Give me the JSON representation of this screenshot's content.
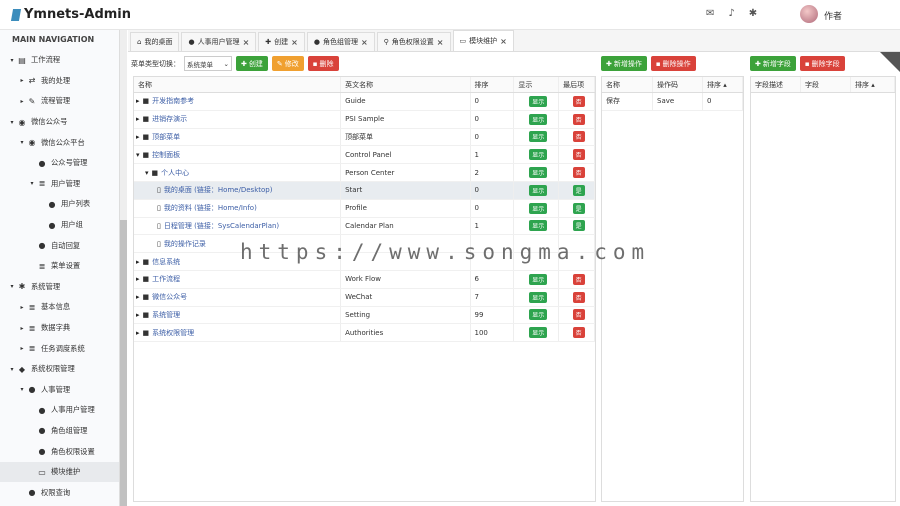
{
  "app": {
    "title": "Ymnets-Admin",
    "user": "作者"
  },
  "sidebar": {
    "header": "MAIN NAVIGATION",
    "items": [
      {
        "label": "工作流程",
        "level": 0,
        "caret": "▾",
        "icon": "▤"
      },
      {
        "label": "我的处理",
        "level": 1,
        "caret": "▸",
        "icon": "⇄"
      },
      {
        "label": "流程管理",
        "level": 1,
        "caret": "▸",
        "icon": "✎"
      },
      {
        "label": "微信公众号",
        "level": 0,
        "caret": "▾",
        "icon": "◉"
      },
      {
        "label": "微信公众平台",
        "level": 1,
        "caret": "▾",
        "icon": "◉"
      },
      {
        "label": "公众号管理",
        "level": 2,
        "caret": "",
        "icon": "●"
      },
      {
        "label": "用户管理",
        "level": 2,
        "caret": "▾",
        "icon": "≣"
      },
      {
        "label": "用户列表",
        "level": 3,
        "caret": "",
        "icon": "●"
      },
      {
        "label": "用户组",
        "level": 3,
        "caret": "",
        "icon": "●"
      },
      {
        "label": "自动回复",
        "level": 2,
        "caret": "",
        "icon": "●"
      },
      {
        "label": "菜单设置",
        "level": 2,
        "caret": "",
        "icon": "≣"
      },
      {
        "label": "系统管理",
        "level": 0,
        "caret": "▾",
        "icon": "✱"
      },
      {
        "label": "基本信息",
        "level": 1,
        "caret": "▸",
        "icon": "≣"
      },
      {
        "label": "数据字典",
        "level": 1,
        "caret": "▸",
        "icon": "≣"
      },
      {
        "label": "任务调度系统",
        "level": 1,
        "caret": "▸",
        "icon": "≣"
      },
      {
        "label": "系统权限管理",
        "level": 0,
        "caret": "▾",
        "icon": "◆"
      },
      {
        "label": "人事管理",
        "level": 1,
        "caret": "▾",
        "icon": "●"
      },
      {
        "label": "人事用户管理",
        "level": 2,
        "caret": "",
        "icon": "●"
      },
      {
        "label": "角色组管理",
        "level": 2,
        "caret": "",
        "icon": "●"
      },
      {
        "label": "角色权限设置",
        "level": 2,
        "caret": "",
        "icon": "●"
      },
      {
        "label": "模块维护",
        "level": 2,
        "caret": "",
        "icon": "▭",
        "active": true
      },
      {
        "label": "权限查询",
        "level": 1,
        "caret": "",
        "icon": "●"
      }
    ]
  },
  "tabs": [
    {
      "label": "我的桌面",
      "icon": "⌂",
      "close": false
    },
    {
      "label": "人事用户管理",
      "icon": "●",
      "close": true
    },
    {
      "label": "创建",
      "icon": "✚",
      "close": true
    },
    {
      "label": "角色组管理",
      "icon": "●",
      "close": true
    },
    {
      "label": "角色权限设置",
      "icon": "⚲",
      "close": true
    },
    {
      "label": "模块维护",
      "icon": "▭",
      "close": true,
      "active": true
    }
  ],
  "toolbar": {
    "menu_type_label": "菜单类型切换：",
    "menu_type_value": "系统菜单",
    "create": "创建",
    "edit": "修改",
    "delete": "删除",
    "add_op": "新增操作",
    "del_op": "删除操作",
    "add_field": "新增字段",
    "del_field": "删除字段"
  },
  "tree": {
    "headers": [
      "名称",
      "英文名称",
      "排序",
      "显示",
      "最后项"
    ],
    "rows": [
      {
        "name": "开发指南参考",
        "en": "Guide",
        "sort": "0",
        "show": "显示",
        "last": "否",
        "level": 0,
        "fold": "▸"
      },
      {
        "name": "进销存演示",
        "en": "PSI Sample",
        "sort": "0",
        "show": "显示",
        "last": "否",
        "level": 0,
        "fold": "▸"
      },
      {
        "name": "顶部菜单",
        "en": "顶部菜单",
        "sort": "0",
        "show": "显示",
        "last": "否",
        "level": 0,
        "fold": "▸"
      },
      {
        "name": "控制面板",
        "en": "Control Panel",
        "sort": "1",
        "show": "显示",
        "last": "否",
        "level": 0,
        "fold": "▾"
      },
      {
        "name": "个人中心",
        "en": "Person Center",
        "sort": "2",
        "show": "显示",
        "last": "否",
        "level": 1,
        "fold": "▾"
      },
      {
        "name": "我的桌面 (链接：Home/Desktop)",
        "en": "Start",
        "sort": "0",
        "show": "显示",
        "last": "是",
        "level": 2,
        "fold": "",
        "selected": true
      },
      {
        "name": "我的资料 (链接：Home/Info)",
        "en": "Profile",
        "sort": "0",
        "show": "显示",
        "last": "是",
        "level": 2,
        "fold": ""
      },
      {
        "name": "日程管理 (链接：SysCalendarPlan)",
        "en": "Calendar Plan",
        "sort": "1",
        "show": "显示",
        "last": "是",
        "level": 2,
        "fold": ""
      },
      {
        "name": "我的操作记录",
        "en": "",
        "sort": "",
        "show": "",
        "last": "",
        "level": 2,
        "fold": ""
      },
      {
        "name": "信息系统",
        "en": "",
        "sort": "",
        "show": "",
        "last": "",
        "level": 0,
        "fold": "▸"
      },
      {
        "name": "工作流程",
        "en": "Work Flow",
        "sort": "6",
        "show": "显示",
        "last": "否",
        "level": 0,
        "fold": "▸"
      },
      {
        "name": "微信公众号",
        "en": "WeChat",
        "sort": "7",
        "show": "显示",
        "last": "否",
        "level": 0,
        "fold": "▸"
      },
      {
        "name": "系统管理",
        "en": "Setting",
        "sort": "99",
        "show": "显示",
        "last": "否",
        "level": 0,
        "fold": "▸"
      },
      {
        "name": "系统权限管理",
        "en": "Authorities",
        "sort": "100",
        "show": "显示",
        "last": "否",
        "level": 0,
        "fold": "▸"
      }
    ]
  },
  "ops": {
    "headers": [
      "名称",
      "操作码",
      "排序 ▴"
    ],
    "rows": [
      {
        "name": "保存",
        "code": "Save",
        "sort": "0"
      }
    ]
  },
  "fields": {
    "headers": [
      "字段描述",
      "字段",
      "排序 ▴"
    ]
  },
  "watermark": "https://www.songma.com"
}
